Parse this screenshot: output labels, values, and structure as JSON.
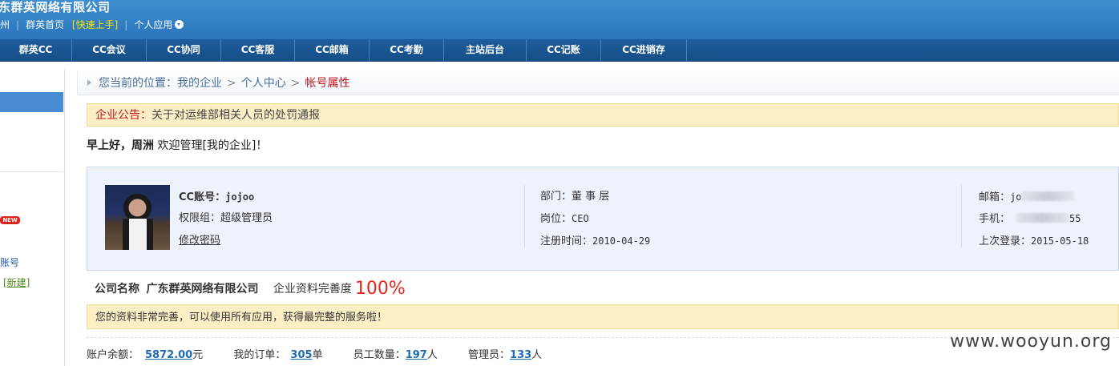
{
  "header": {
    "company_title": "东群英网络有限公司",
    "links": {
      "prefix": "州",
      "home": "群英首页",
      "quickstart": "[快速上手]",
      "personal_apps": "个人应用"
    }
  },
  "nav": {
    "items": [
      "群英CC",
      "CC会议",
      "CC协同",
      "CC客服",
      "CC邮箱",
      "CC考勤",
      "主站后台",
      "CC记账",
      "CC进销存"
    ]
  },
  "sidebar": {
    "new_badge": "NEW",
    "account_label": "账号",
    "new_link": "[新建]"
  },
  "breadcrumb": {
    "prefix": "您当前的位置：",
    "crumbs": [
      "我的企业",
      "个人中心"
    ],
    "current": "帐号属性",
    "separator": ">"
  },
  "notice": {
    "label": "企业公告：",
    "text": "关于对运维部相关人员的处罚通报"
  },
  "greeting": {
    "hello": "早上好，周洲",
    "welcome": "欢迎管理[我的企业]！"
  },
  "profile": {
    "cc_account_label": "CC账号：",
    "cc_account_value": "jojoo",
    "permission": "权限组：超级管理员",
    "change_password": "修改密码",
    "department": "部门：董 事 层",
    "position_label": "岗位：",
    "position_value": "CEO",
    "register_label": "注册时间：",
    "register_value": "2010-04-29",
    "email_label": "邮箱：",
    "email_value_visible": "jo",
    "mobile_label": "手机：",
    "mobile_value_visible": "55",
    "last_login_label": "上次登录：",
    "last_login_value": "2015-05-18"
  },
  "company": {
    "name_label": "公司名称",
    "name": "广东群英网络有限公司",
    "completeness_label": "企业资料完善度",
    "completeness_value": "100%"
  },
  "tip": {
    "text": "您的资料非常完善，可以使用所有应用，获得最完整的服务啦！"
  },
  "stats": {
    "balance_label": "账户余额：",
    "balance_value": "5872.00",
    "balance_unit": "元",
    "orders_label": "我的订单：",
    "orders_value": "305",
    "orders_unit": "单",
    "employees_label": "员工数量：",
    "employees_value": "197",
    "employees_unit": "人",
    "admins_label": "管理员：",
    "admins_value": "133",
    "admins_unit": "人"
  },
  "watermark": "www.wooyun.org",
  "colors": {
    "header_blue": "#2a74bc",
    "nav_blue": "#1d5d9e",
    "alert_red": "#c4161c",
    "percent_red": "#e0281e",
    "link_blue": "#1e6bb8",
    "notice_bg": "#fcefc6"
  }
}
